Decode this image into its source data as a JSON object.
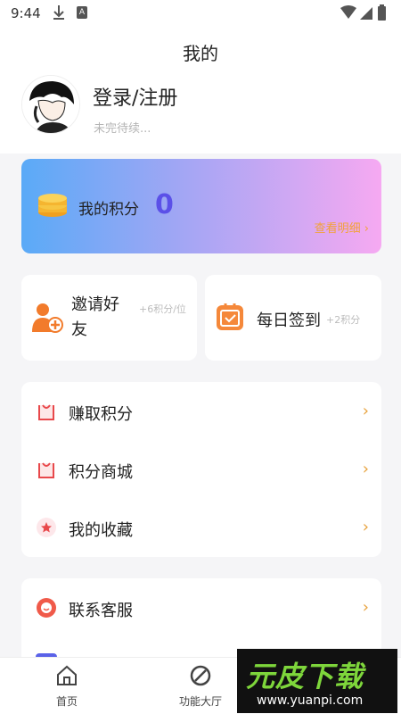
{
  "status_bar": {
    "time": "9:44",
    "a_badge": "A"
  },
  "page": {
    "title": "我的"
  },
  "profile": {
    "login": "登录/注册",
    "subtitle": "未完待续..."
  },
  "points": {
    "label": "我的积分",
    "value": "0",
    "detail": "查看明细 ›"
  },
  "invite": {
    "label": "邀请好友",
    "bonus": "+6积分/位"
  },
  "checkin": {
    "label": "每日签到",
    "bonus": "+2积分"
  },
  "menu1": [
    {
      "label": "赚取积分",
      "icon": "bag-icon"
    },
    {
      "label": "积分商城",
      "icon": "bag-icon"
    },
    {
      "label": "我的收藏",
      "icon": "star-icon"
    }
  ],
  "menu2": [
    {
      "label": "联系客服",
      "icon": "service-icon"
    }
  ],
  "arrow": "›",
  "bottom_nav": {
    "home": "首页",
    "features": "功能大厅"
  },
  "watermark": {
    "main": "元皮下载",
    "url": "www.yuanpi.com"
  },
  "colors": {
    "accent": "#5b50e8",
    "orange": "#f2a23a",
    "red": "#e8484b"
  }
}
